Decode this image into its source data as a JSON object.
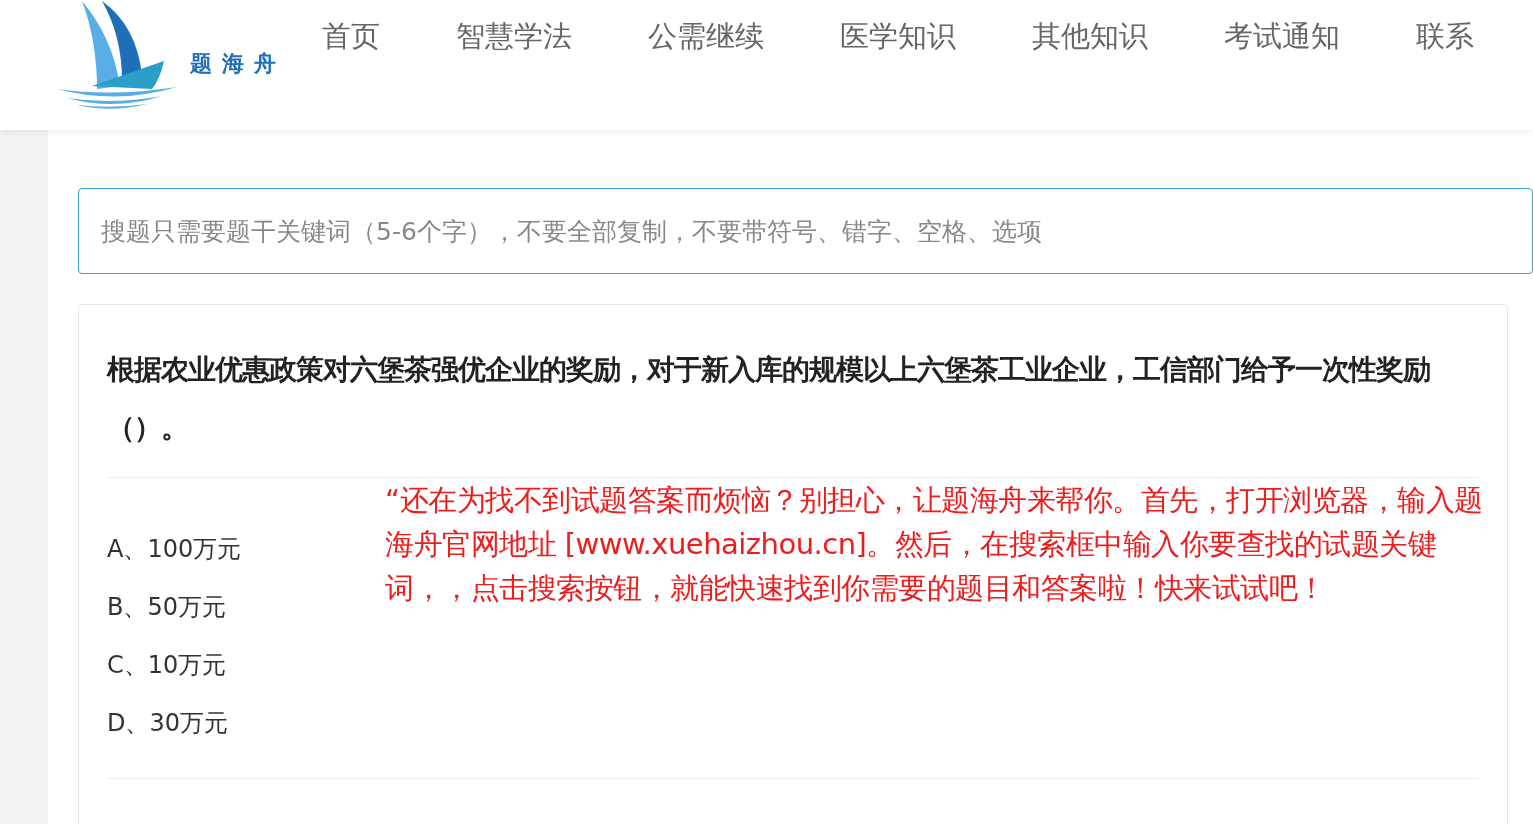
{
  "header": {
    "logo_text": "题海舟",
    "nav": [
      {
        "label": "首页"
      },
      {
        "label": "智慧学法"
      },
      {
        "label": "公需继续"
      },
      {
        "label": "医学知识"
      },
      {
        "label": "其他知识"
      },
      {
        "label": "考试通知"
      },
      {
        "label": "联系"
      }
    ]
  },
  "search": {
    "placeholder": "搜题只需要题干关键词（5-6个字），不要全部复制，不要带符号、错字、空格、选项"
  },
  "question": {
    "text": "根据农业优惠政策对六堡茶强优企业的奖励，对于新入库的规模以上六堡茶工业企业，工信部门给予一次性奖励（）。",
    "options": [
      {
        "label": "A、100万元"
      },
      {
        "label": "B、50万元"
      },
      {
        "label": "C、10万元"
      },
      {
        "label": "D、30万元"
      }
    ],
    "notice": "“还在为找不到试题答案而烦恼？别担心，让题海舟来帮你。首先，打开浏览器，输入题海舟官网地址 [www.xuehaizhou.cn]。然后，在搜索框中输入你要查找的试题关键词，，点击搜索按钮，就能快速找到你需要的题目和答案啦！快来试试吧！"
  }
}
